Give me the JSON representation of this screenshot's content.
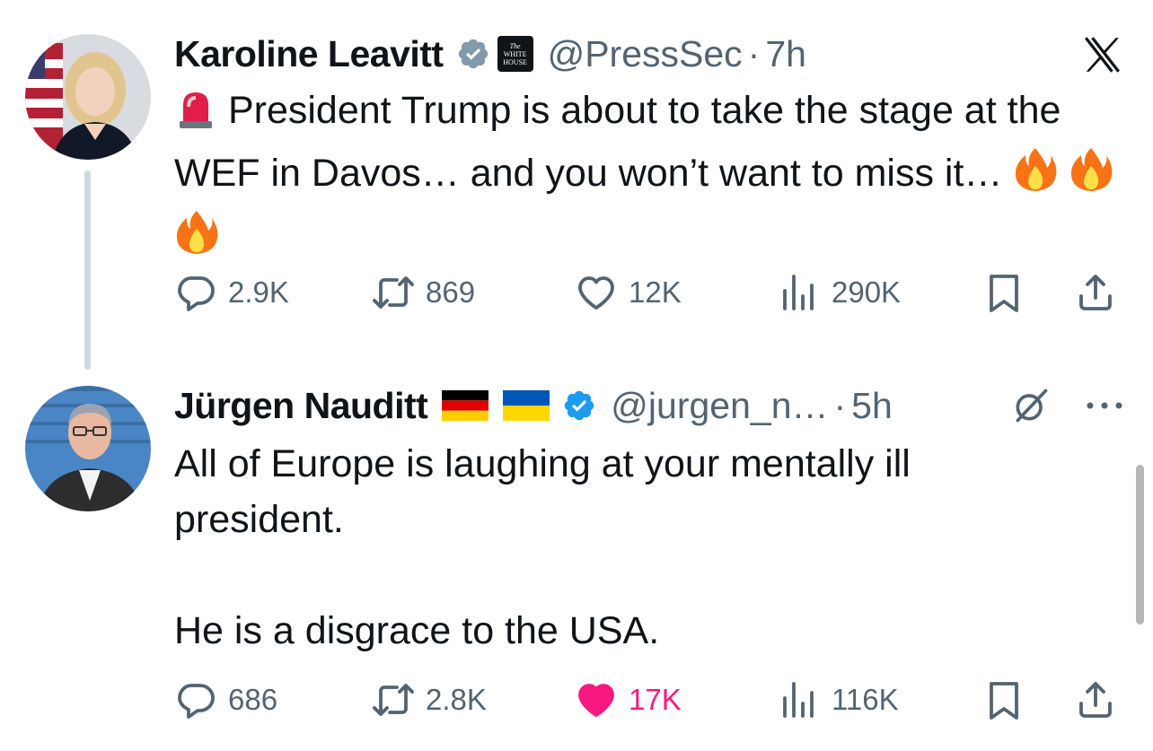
{
  "tweets": [
    {
      "display_name": "Karoline Leavitt",
      "affiliation_badge": {
        "line1": "The",
        "line2": "WHITE",
        "line3": "HOUSE"
      },
      "handle": "@PressSec",
      "dot": "·",
      "time": "7h",
      "text": "President Trump is about to take the stage at the WEF in Davos… and you won’t want to miss it…",
      "leading_emoji": "rotating-light",
      "trailing_emojis": [
        "fire",
        "fire",
        "fire"
      ],
      "metrics": {
        "replies": "2.9K",
        "reposts": "869",
        "likes": "12K",
        "views": "290K"
      },
      "liked": false,
      "verified_color": "#829aab"
    },
    {
      "display_name": "Jürgen Nauditt",
      "flags": [
        "germany-flag",
        "ukraine-flag"
      ],
      "handle": "@jurgen_n…",
      "dot": "·",
      "time": "5h",
      "text_line1": "All of Europe is laughing at your mentally ill",
      "text_line2": "president.",
      "text_line3": "He is a disgrace to the USA.",
      "metrics": {
        "replies": "686",
        "reposts": "2.8K",
        "likes": "17K",
        "views": "116K"
      },
      "liked": true,
      "verified_color": "#1d9bf0"
    }
  ],
  "colors": {
    "like_active": "#f91880",
    "secondary_text": "#536471",
    "thread_line": "#cfd9de"
  },
  "icons": [
    "x-logo",
    "grok-icon",
    "more-icon",
    "reply-icon",
    "retweet-icon",
    "like-icon",
    "views-icon",
    "bookmark-icon",
    "share-icon"
  ]
}
